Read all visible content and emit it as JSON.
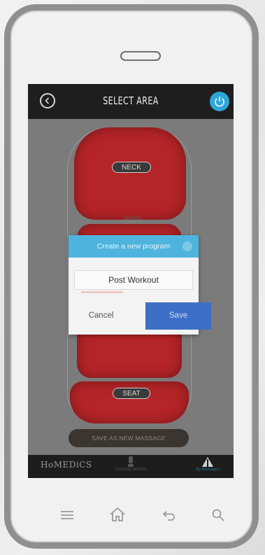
{
  "app": {
    "title": "SELECT AREA",
    "brand": "HoMEDiCS"
  },
  "areas": {
    "neck_label": "NECK",
    "seat_label": "SEAT",
    "mid_caption": "SHIATSU"
  },
  "actions": {
    "save_new_label": "SAVE AS NEW MASSAGE"
  },
  "bottom_nav": {
    "middle_label": "CHOOSE AREAS",
    "right_label": "My Massages"
  },
  "dialog": {
    "title": "Create a new program",
    "input_value": "Post Workout",
    "cancel_label": "Cancel",
    "save_label": "Save"
  },
  "colors": {
    "accent": "#2ea7d8",
    "dialog_header": "#4fb4dd",
    "save_button": "#3d6fc7",
    "pad_red": "#b52427"
  },
  "icons": {
    "back": "chevron-left-icon",
    "power": "power-icon",
    "close": "close-icon",
    "menu": "menu-icon",
    "home": "home-icon",
    "return": "back-arrow-icon",
    "search": "search-icon"
  }
}
